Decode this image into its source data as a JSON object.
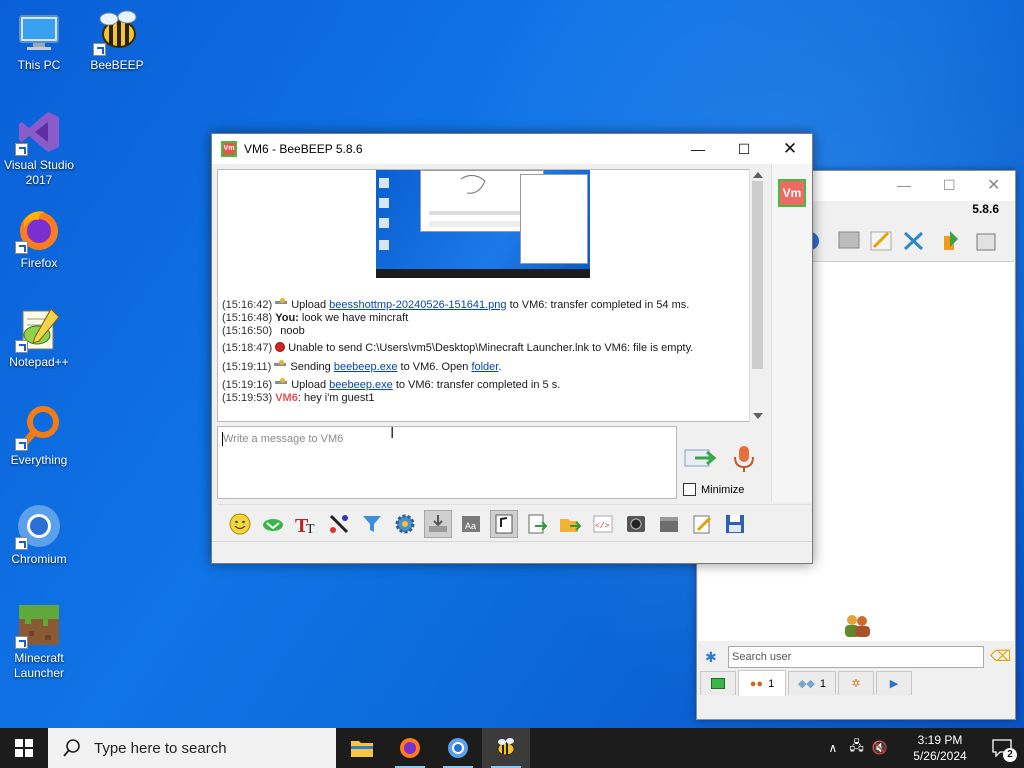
{
  "desktop": {
    "icons": [
      {
        "label": "This PC"
      },
      {
        "label": "BeeBEEP"
      },
      {
        "label": "Visual Studio 2017"
      },
      {
        "label": "Firefox"
      },
      {
        "label": "Notepad++"
      },
      {
        "label": "Everything"
      },
      {
        "label": "Chromium"
      },
      {
        "label": "Minecraft Launcher"
      }
    ]
  },
  "chat_window": {
    "title": "VM6 - BeeBEEP 5.8.6",
    "app_badge": "Vm",
    "peer_badge": "Vm",
    "messages": [
      {
        "time": "(15:16:42)",
        "icon": "transfer-icon",
        "pre": "Upload ",
        "link": "beesshottmp-20240526-151641.png",
        "post": " to VM6: transfer completed in 54 ms."
      },
      {
        "time": "(15:16:48)",
        "sender": "You:",
        "text": " look we have mincraft"
      },
      {
        "time": "(15:16:50)",
        "text": "noob"
      },
      {
        "time": "(15:18:47)",
        "icon": "error-icon",
        "text": "Unable to send C:\\Users\\vm5\\Desktop\\Minecraft Launcher.lnk to VM6: file is empty."
      },
      {
        "time": "(15:19:11)",
        "icon": "transfer-icon",
        "pre": "Sending ",
        "link": "beebeep.exe",
        "mid": " to VM6. Open ",
        "link2": "folder",
        "post": "."
      },
      {
        "time": "(15:19:16)",
        "icon": "transfer-icon",
        "pre": "Upload ",
        "link": "beebeep.exe",
        "post": " to VM6: transfer completed in 5 s."
      },
      {
        "time": "(15:19:53)",
        "peer": "VM6",
        "text": ": hey i'm guest1"
      }
    ],
    "compose_placeholder": "Write a message to VM6",
    "minimize_label": "Minimize",
    "toolbar_icons": [
      "emoji-icon",
      "green-chevron-icon",
      "font-icon",
      "color-picker-icon",
      "filter-icon",
      "settings-gear-icon",
      "tray-icon",
      "contact-card-icon",
      "note-icon",
      "send-file-icon",
      "send-folder-icon",
      "html-icon",
      "screenshot-icon",
      "storage-icon",
      "edit-icon",
      "save-icon"
    ]
  },
  "main_window": {
    "version": "5.8.6",
    "search_placeholder": "Search user",
    "tabs": [
      {
        "icon": "status-green-icon",
        "label": ""
      },
      {
        "icon": "users-icon",
        "label": "1"
      },
      {
        "icon": "chats-icon",
        "label": "1"
      },
      {
        "icon": "groups-icon",
        "label": ""
      },
      {
        "icon": "flag-icon",
        "label": ""
      }
    ]
  },
  "taskbar": {
    "search_placeholder": "Type here to search",
    "time": "3:19 PM",
    "date": "5/26/2024",
    "notification_count": "2"
  }
}
